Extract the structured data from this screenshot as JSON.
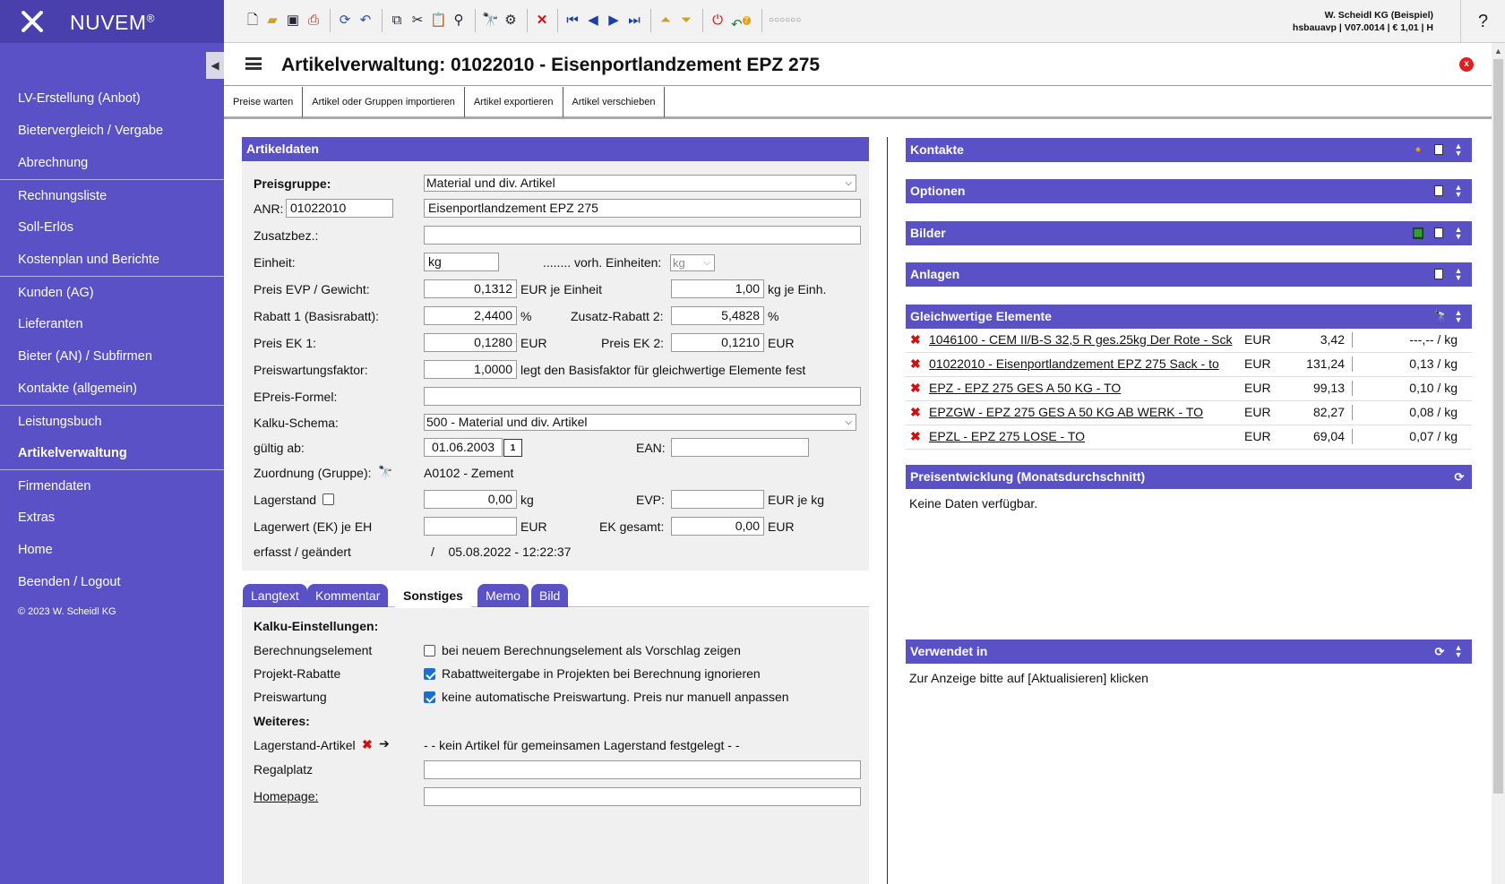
{
  "app": {
    "brand": "NUVEM",
    "reg": "®"
  },
  "sidebar": {
    "collapse_glyph": "◀",
    "items": [
      {
        "label": "LV-Erstellung (Anbot)"
      },
      {
        "label": "Bietervergleich / Vergabe"
      },
      {
        "label": "Abrechnung"
      },
      {
        "label": "Rechnungsliste"
      },
      {
        "label": "Soll-Erlös"
      },
      {
        "label": "Kostenplan und Berichte"
      },
      {
        "label": "Kunden (AG)"
      },
      {
        "label": "Lieferanten"
      },
      {
        "label": "Bieter (AN) / Subfirmen"
      },
      {
        "label": "Kontakte (allgemein)"
      },
      {
        "label": "Leistungsbuch"
      },
      {
        "label": "Artikelverwaltung"
      },
      {
        "label": "Firmendaten"
      },
      {
        "label": "Extras"
      },
      {
        "label": "Home"
      },
      {
        "label": "Beenden / Logout"
      }
    ],
    "copyright": "© 2023 W. Scheidl KG"
  },
  "toolbar": {
    "user_line1": "W. Scheidl KG (Beispiel)",
    "user_line2": "hsbauavp | V07.0014 | € 1,01 | H",
    "help": "?",
    "badge": "7",
    "dots": "○○○○○○"
  },
  "title": {
    "text": "Artikelverwaltung: 01022010 - Eisenportlandzement EPZ 275",
    "close": "x"
  },
  "actions": [
    "Preise warten",
    "Artikel oder Gruppen importieren",
    "Artikel exportieren",
    "Artikel verschieben"
  ],
  "artikeldaten": {
    "header": "Artikeldaten",
    "preisgruppe_label": "Preisgruppe:",
    "preisgruppe": "Material und div. Artikel",
    "anr_label": "ANR:",
    "anr": "01022010",
    "bezeichnung": "Eisenportlandzement EPZ 275",
    "zusatzbez_label": "Zusatzbez.:",
    "zusatzbez": "",
    "einheit_label": "Einheit:",
    "einheit": "kg",
    "vorh_label": "........ vorh. Einheiten:",
    "vorh": "kg",
    "preis_evp_label": "Preis EVP / Gewicht:",
    "preis_evp": "0,1312",
    "preis_evp_unit": "EUR je Einheit",
    "gewicht": "1,00",
    "gewicht_unit": "kg je Einh.",
    "rabatt1_label": "Rabatt 1 (Basisrabatt):",
    "rabatt1": "2,4400",
    "pct": "%",
    "zusatz_rabatt_label": "Zusatz-Rabatt 2:",
    "zusatz_rabatt": "5,4828",
    "preis_ek1_label": "Preis EK 1:",
    "preis_ek1": "0,1280",
    "eur": "EUR",
    "preis_ek2_label": "Preis EK 2:",
    "preis_ek2": "0,1210",
    "pwf_label": "Preiswartungsfaktor:",
    "pwf": "1,0000",
    "pwf_note": "legt den Basisfaktor für gleichwertige Elemente fest",
    "epreis_label": "EPreis-Formel:",
    "epreis": "",
    "kalku_label": "Kalku-Schema:",
    "kalku": "500 - Material und div. Artikel",
    "gueltig_label": "gültig ab:",
    "gueltig": "01.06.2003",
    "cal": "1",
    "ean_label": "EAN:",
    "ean": "",
    "zuordnung_label": "Zuordnung (Gruppe):",
    "zuordnung": "A0102 - Zement",
    "lagerstand_label": "Lagerstand",
    "lagerstand": "0,00",
    "kg": "kg",
    "evp_label": "EVP:",
    "evp": "",
    "evp_unit": "EUR je kg",
    "lagerwert_label": "Lagerwert (EK) je EH",
    "lagerwert": "",
    "ek_gesamt_label": "EK gesamt:",
    "ek_gesamt": "0,00",
    "erfasst_label": "erfasst / geändert",
    "erfasst": "/    05.08.2022 - 12:22:37"
  },
  "tabs": [
    {
      "label": "Langtext"
    },
    {
      "label": "Kommentar"
    },
    {
      "label": "Sonstiges"
    },
    {
      "label": "Memo"
    },
    {
      "label": "Bild"
    }
  ],
  "sonstiges": {
    "kalku_heading": "Kalku-Einstellungen:",
    "berechnung_label": "Berechnungselement",
    "berechnung_text": "bei neuem Berechnungselement als Vorschlag zeigen",
    "projekt_label": "Projekt-Rabatte",
    "projekt_text": "Rabattweitergabe in Projekten bei Berechnung ignorieren",
    "preiswartung_label": "Preiswartung",
    "preiswartung_text": "keine automatische Preiswartung. Preis nur manuell anpassen",
    "weiteres_heading": "Weiteres:",
    "lagerstand_artikel_label": "Lagerstand-Artikel",
    "lagerstand_artikel_text": "- - kein Artikel für gemeinsamen Lagerstand festgelegt - -",
    "regal_label": "Regalplatz",
    "regal": "",
    "homepage_label": "Homepage:",
    "homepage": ""
  },
  "right": {
    "kontakte": "Kontakte",
    "optionen": "Optionen",
    "bilder": "Bilder",
    "anlagen": "Anlagen",
    "gleich_header": "Gleichwertige Elemente",
    "gleich": [
      {
        "name": "1046100 - CEM II/B-S 32,5 R ges.25kg Der Rote - Sck",
        "cur": "EUR",
        "val": "3,42",
        "per": "---,-- / kg"
      },
      {
        "name": "01022010 - Eisenportlandzement EPZ 275 Sack - to",
        "cur": "EUR",
        "val": "131,24",
        "per": "0,13 / kg"
      },
      {
        "name": "EPZ - EPZ 275 GES A 50 KG - TO",
        "cur": "EUR",
        "val": "99,13",
        "per": "0,10 / kg"
      },
      {
        "name": "EPZGW - EPZ 275 GES A 50 KG AB WERK - TO",
        "cur": "EUR",
        "val": "82,27",
        "per": "0,08 / kg"
      },
      {
        "name": "EPZL - EPZ 275 LOSE - TO",
        "cur": "EUR",
        "val": "69,04",
        "per": "0,07 / kg"
      }
    ],
    "preis_header": "Preisentwicklung (Monatsdurchschnitt)",
    "preis_text": "Keine Daten verfügbar.",
    "verwendet_header": "Verwendet in",
    "verwendet_text": "Zur Anzeige bitte auf [Aktualisieren] klicken"
  }
}
